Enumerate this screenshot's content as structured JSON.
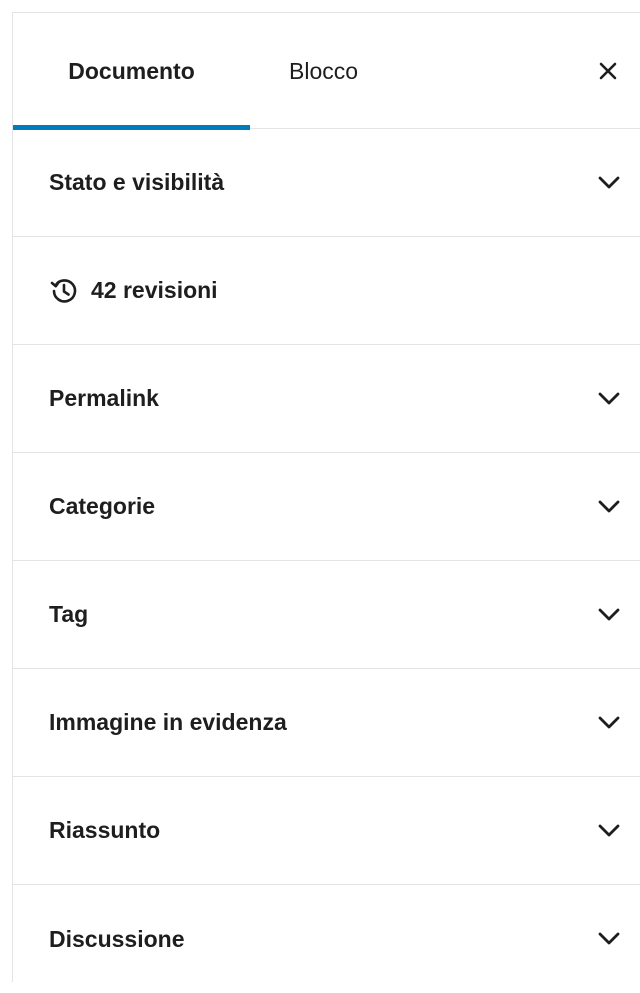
{
  "tabs": {
    "document": "Documento",
    "block": "Blocco"
  },
  "close_icon": "close-icon",
  "revisions": {
    "label": "42 revisioni",
    "icon": "history-icon"
  },
  "panels": [
    {
      "label": "Stato e visibilità"
    },
    {
      "label": "Permalink"
    },
    {
      "label": "Categorie"
    },
    {
      "label": "Tag"
    },
    {
      "label": "Immagine in evidenza"
    },
    {
      "label": "Riassunto"
    },
    {
      "label": "Discussione"
    }
  ],
  "colors": {
    "accent": "#007cba",
    "text": "#1e1e1e",
    "divider": "#e2e4e7"
  }
}
